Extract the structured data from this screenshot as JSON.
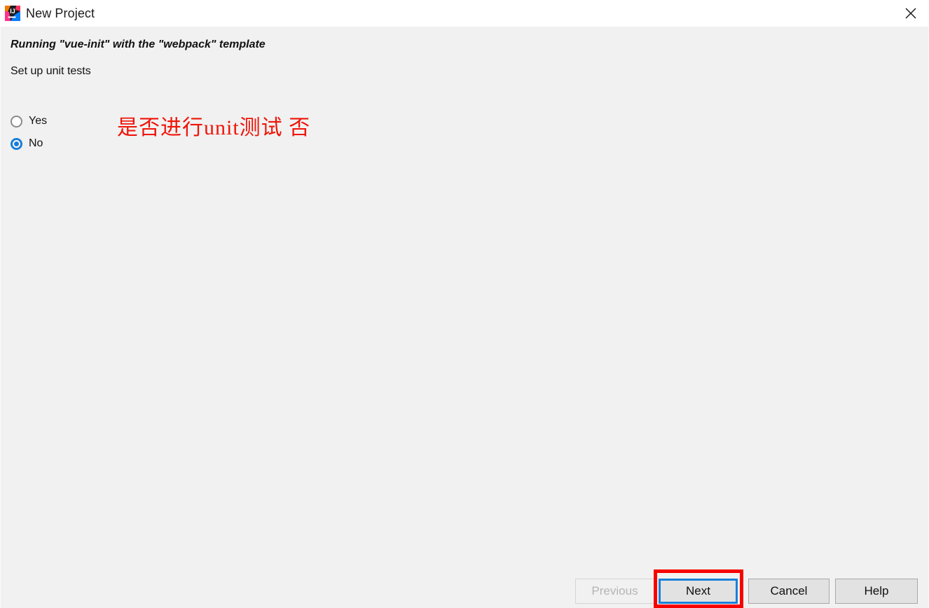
{
  "window": {
    "title": "New Project",
    "icon": "intellij-idea-icon",
    "close_label": "✕"
  },
  "content": {
    "running_line": "Running \"vue-init\" with the \"webpack\" template",
    "question_label": "Set up unit tests",
    "options": [
      {
        "label": "Yes",
        "selected": false
      },
      {
        "label": "No",
        "selected": true
      }
    ],
    "annotation": {
      "text": "是否进行unit测试 否",
      "color": "#f01408"
    }
  },
  "buttons": {
    "previous": {
      "label": "Previous",
      "enabled": false
    },
    "next": {
      "label": "Next",
      "enabled": true,
      "focused": true,
      "highlighted": true
    },
    "cancel": {
      "label": "Cancel",
      "enabled": true
    },
    "help": {
      "label": "Help",
      "enabled": true
    }
  },
  "colors": {
    "accent_blue": "#1a7ed8",
    "focus_blue": "#1a80d8",
    "annotation_red": "#f60000",
    "panel_bg": "#f1f1f1",
    "titlebar_bg": "#ffffff",
    "button_bg": "#e2e2e2"
  }
}
